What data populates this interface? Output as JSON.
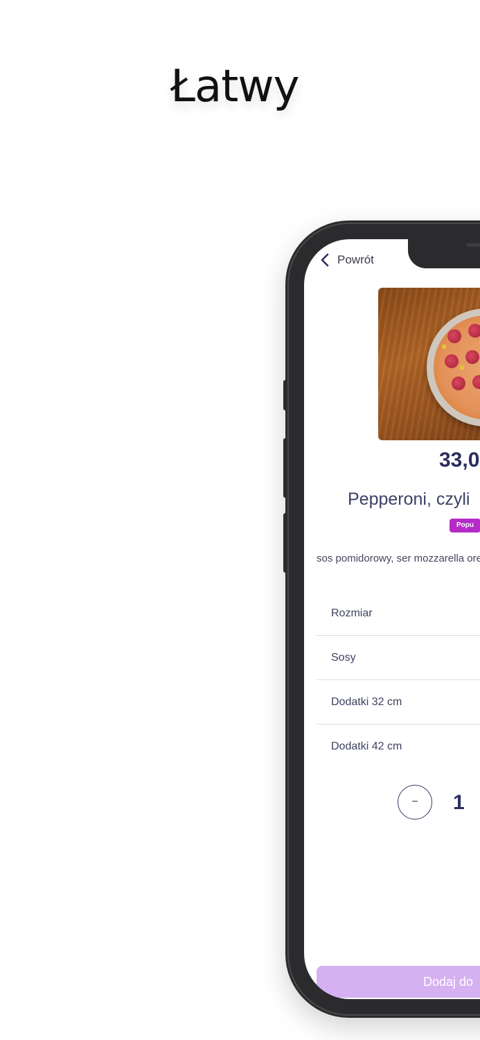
{
  "headline": "Łatwy",
  "nav": {
    "back_label": "Powrót"
  },
  "product": {
    "price": "33,0",
    "title": "Pepperoni, czyli",
    "badge": "Popu",
    "description": "sos pomidorowy, ser mozzarella oregano",
    "image_icon": "pizza-photo"
  },
  "options": [
    {
      "label": "Rozmiar"
    },
    {
      "label": "Sosy"
    },
    {
      "label": "Dodatki 32 cm"
    },
    {
      "label": "Dodatki 42 cm"
    }
  ],
  "quantity": {
    "minus_label": "−",
    "value": "1"
  },
  "cta": {
    "label": "Dodaj do"
  },
  "colors": {
    "accent": "#2c2f5e",
    "badge": "#b62bc7",
    "cta": "#d6b1f2",
    "phone_frame": "#2b2b2d"
  }
}
